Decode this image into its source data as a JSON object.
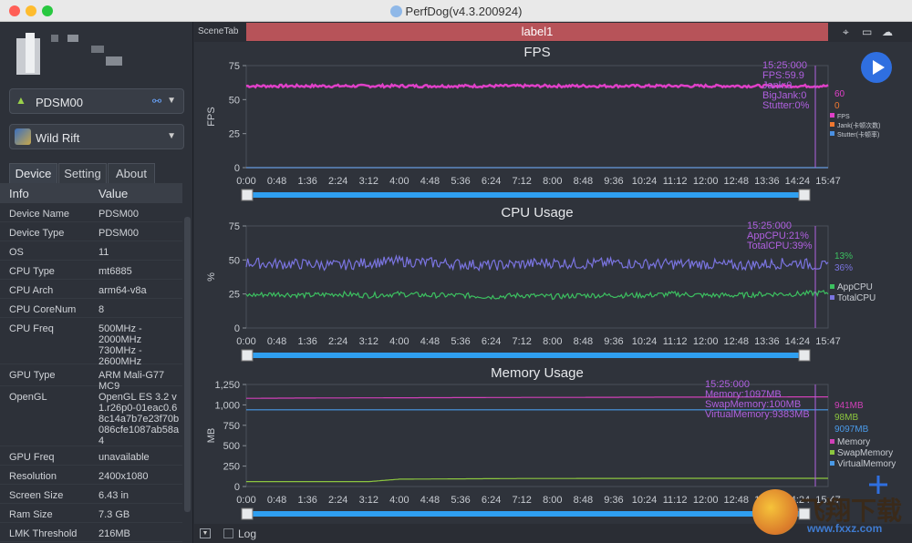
{
  "app_title": "PerfDog(v4.3.200924)",
  "sidebar": {
    "device_select": "PDSM00",
    "app_select": "Wild Rift",
    "tabs": [
      "Device",
      "Setting",
      "About"
    ],
    "table_headers": [
      "Info",
      "Value"
    ],
    "rows": [
      {
        "k": "Device Name",
        "v": "PDSM00"
      },
      {
        "k": "Device Type",
        "v": "PDSM00"
      },
      {
        "k": "OS",
        "v": "11"
      },
      {
        "k": "CPU Type",
        "v": "mt6885"
      },
      {
        "k": "CPU Arch",
        "v": "arm64-v8a"
      },
      {
        "k": "CPU CoreNum",
        "v": "8"
      },
      {
        "k": "CPU Freq",
        "v": "500MHz - 2000MHz 730MHz - 2600MHz"
      },
      {
        "k": "GPU Type",
        "v": "ARM Mali-G77 MC9"
      },
      {
        "k": "OpenGL",
        "v": "OpenGL ES 3.2 v1.r26p0-01eac0.68c14a7b7e23f70b086cfe1087ab58a4"
      },
      {
        "k": "GPU Freq",
        "v": "unavailable"
      },
      {
        "k": "Resolution",
        "v": "2400x1080"
      },
      {
        "k": "Screen Size",
        "v": "6.43 in"
      },
      {
        "k": "Ram Size",
        "v": "7.3 GB"
      },
      {
        "k": "LMK Threshold",
        "v": "216MB"
      }
    ]
  },
  "toolbar": {
    "scene_tab": "SceneTab",
    "label": "label1"
  },
  "bottom": {
    "log_label": "Log"
  },
  "watermark": {
    "text": "飞翔下载",
    "url": "www.fxxz.com"
  },
  "colors": {
    "fps": "#e040c8",
    "jank": "#f07830",
    "stutter": "#4a90e2",
    "appcpu": "#3cc060",
    "totalcpu": "#7a74e0",
    "memory": "#d040b8",
    "swap": "#8cc63f",
    "virtual": "#4a9ae8",
    "cursor": "#b060e0"
  },
  "chart_data": [
    {
      "type": "line",
      "title": "FPS",
      "xlabel": "",
      "ylabel": "FPS",
      "ylim": [
        0,
        75
      ],
      "yticks": [
        "0",
        "25",
        "50",
        "75"
      ],
      "x": [
        "0:00",
        "0:48",
        "1:36",
        "2:24",
        "3:12",
        "4:00",
        "4:48",
        "5:36",
        "6:24",
        "7:12",
        "8:00",
        "8:48",
        "9:36",
        "10:24",
        "11:12",
        "12:00",
        "12:48",
        "13:36",
        "14:24",
        "15:47"
      ],
      "series": [
        {
          "name": "FPS",
          "values": [
            60,
            60,
            60,
            60,
            60,
            60,
            60,
            60,
            60,
            60,
            60,
            60,
            60,
            60,
            60,
            60,
            60,
            60,
            60,
            60
          ]
        },
        {
          "name": "Jank(卡顿次数)",
          "values": [
            0,
            0,
            0,
            0,
            0,
            0,
            0,
            0,
            0,
            0,
            0,
            0,
            0,
            0,
            0,
            0,
            0,
            0,
            0,
            0
          ]
        },
        {
          "name": "Stutter(卡顿率)",
          "values": [
            0,
            0,
            0,
            0,
            0,
            0,
            0,
            0,
            0,
            0,
            0,
            0,
            0,
            0,
            0,
            0,
            0,
            0,
            0,
            0
          ]
        }
      ],
      "end_labels": [
        "60",
        "0"
      ],
      "tooltip": [
        "15:25:000",
        "FPS:59.9",
        "Jank:0",
        "BigJank:0",
        "Stutter:0%"
      ],
      "legend": "right"
    },
    {
      "type": "line",
      "title": "CPU Usage",
      "xlabel": "",
      "ylabel": "%",
      "ylim": [
        0,
        75
      ],
      "yticks": [
        "0",
        "25",
        "50",
        "75"
      ],
      "x": [
        "0:00",
        "0:48",
        "1:36",
        "2:24",
        "3:12",
        "4:00",
        "4:48",
        "5:36",
        "6:24",
        "7:12",
        "8:00",
        "8:48",
        "9:36",
        "10:24",
        "11:12",
        "12:00",
        "12:48",
        "13:36",
        "14:24",
        "15:47"
      ],
      "series": [
        {
          "name": "AppCPU",
          "values": [
            24,
            25,
            24,
            25,
            24,
            25,
            24,
            24,
            23,
            24,
            23,
            24,
            24,
            24,
            25,
            24,
            24,
            25,
            25,
            26
          ]
        },
        {
          "name": "TotalCPU",
          "values": [
            48,
            47,
            47,
            46,
            48,
            49,
            48,
            47,
            46,
            47,
            48,
            47,
            48,
            47,
            47,
            47,
            46,
            47,
            48,
            45
          ]
        }
      ],
      "end_labels": [
        "13%",
        "36%"
      ],
      "tooltip": [
        "15:25:000",
        "AppCPU:21%",
        "TotalCPU:39%"
      ],
      "legend": "right"
    },
    {
      "type": "line",
      "title": "Memory Usage",
      "xlabel": "",
      "ylabel": "MB",
      "ylim": [
        0,
        1250
      ],
      "yticks": [
        "0",
        "250",
        "500",
        "750",
        "1,000",
        "1,250"
      ],
      "x": [
        "0:00",
        "0:48",
        "1:36",
        "2:24",
        "3:12",
        "4:00",
        "4:48",
        "5:36",
        "6:24",
        "7:12",
        "8:00",
        "8:48",
        "9:36",
        "10:24",
        "11:12",
        "12:00",
        "12:48",
        "13:36",
        "14:24",
        "15:47"
      ],
      "series": [
        {
          "name": "Memory",
          "values": [
            1080,
            1082,
            1084,
            1085,
            1086,
            1087,
            1088,
            1089,
            1090,
            1091,
            1091,
            1092,
            1093,
            1094,
            1095,
            1095,
            1096,
            1097,
            1098,
            1098
          ]
        },
        {
          "name": "SwapMemory",
          "values": [
            60,
            60,
            60,
            60,
            60,
            90,
            92,
            94,
            96,
            98,
            98,
            99,
            99,
            100,
            100,
            100,
            100,
            100,
            100,
            100
          ]
        },
        {
          "name": "VirtualMemory",
          "values": [
            940,
            940,
            940,
            940,
            940,
            940,
            940,
            940,
            940,
            940,
            940,
            940,
            940,
            940,
            940,
            940,
            940,
            940,
            940,
            940
          ]
        }
      ],
      "end_labels": [
        "941MB",
        "98MB",
        "9097MB"
      ],
      "tooltip": [
        "15:25:000",
        "Memory:1097MB",
        "SwapMemory:100MB",
        "VirtualMemory:9383MB"
      ],
      "legend": "right"
    }
  ]
}
